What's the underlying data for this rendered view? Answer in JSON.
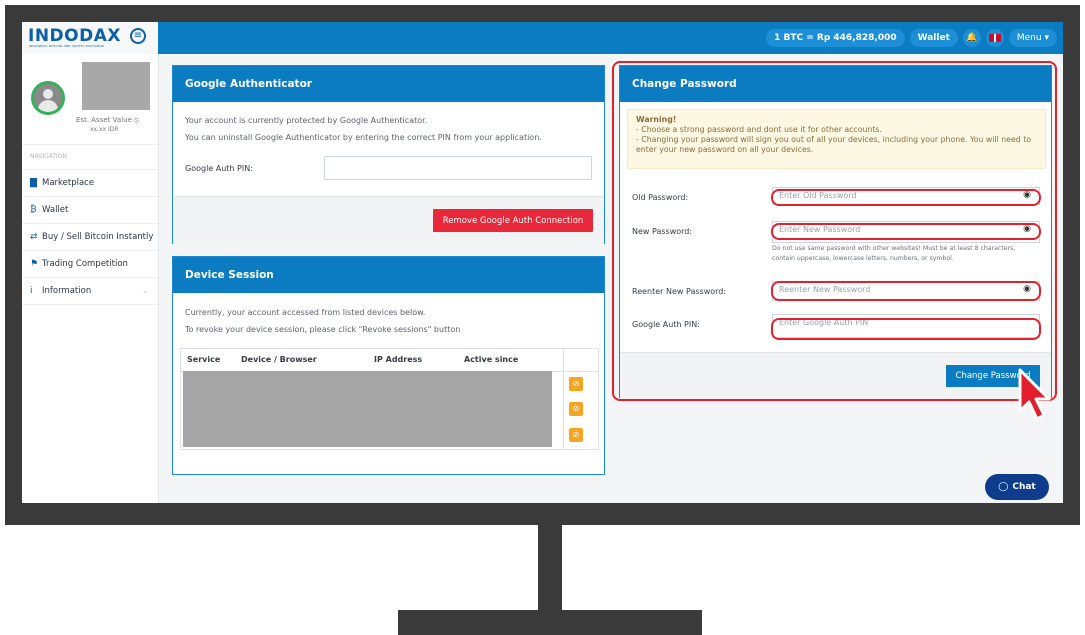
{
  "brand": {
    "logo": "INDODAX",
    "tagline": "INDONESIA BITCOIN AND CRYPTO EXCHANGE"
  },
  "topbar": {
    "btc_rate": "1 BTC = Rp 446,828,000",
    "wallet_label": "Wallet",
    "menu_label": "Menu"
  },
  "sidebar": {
    "asset_label": "Est. Asset Value",
    "asset_value": "xx.xx IDR",
    "nav_heading": "NAVIGATION",
    "items": [
      {
        "label": "Marketplace",
        "icon": "bar-chart-icon"
      },
      {
        "label": "Wallet",
        "icon": "bitcoin-icon"
      },
      {
        "label": "Buy / Sell Bitcoin Instantly",
        "icon": "exchange-icon"
      },
      {
        "label": "Trading Competition",
        "icon": "flag-icon"
      },
      {
        "label": "Information",
        "icon": "info-icon"
      }
    ]
  },
  "google_auth": {
    "title": "Google Authenticator",
    "line1": "Your account is currently protected by Google Authenticator.",
    "line2": "You can uninstall Google Authenticator by entering the correct PIN from your application.",
    "pin_label": "Google Auth PIN:",
    "remove_button": "Remove Google Auth Connection"
  },
  "device_session": {
    "title": "Device Session",
    "line1": "Currently, your account accessed from listed devices below.",
    "line2": "To revoke your device session, please click \"Revoke sessions\" button",
    "columns": [
      "Service",
      "Device / Browser",
      "IP Address",
      "Active since"
    ]
  },
  "change_password": {
    "title": "Change Password",
    "warning_title": "Warning!",
    "warning_line1": "- Choose a strong password and dont use it for other accounts.",
    "warning_line2": "- Changing your password will sign you out of all your devices, including your phone. You will need to",
    "warning_line3": "enter your new password on all your devices.",
    "old_label": "Old Password:",
    "old_placeholder": "Enter Old Password",
    "new_label": "New Password:",
    "new_placeholder": "Enter New Password",
    "hint_line1": "Do not use same password with other websites! Must be at least 8 characters,",
    "hint_line2": "contain uppercase, lowercase letters, numbers, or symbol.",
    "reenter_label": "Reenter New Password:",
    "reenter_placeholder": "Reenter New Password",
    "pin_label": "Google Auth PIN:",
    "pin_placeholder": "Enter Google Auth PIN",
    "submit_button": "Change Password"
  },
  "chat": {
    "label": "Chat"
  },
  "colors": {
    "primary": "#0b7cc1",
    "danger": "#e8283a",
    "highlight": "#e0222e",
    "warning_bg": "#fcf8e3"
  }
}
